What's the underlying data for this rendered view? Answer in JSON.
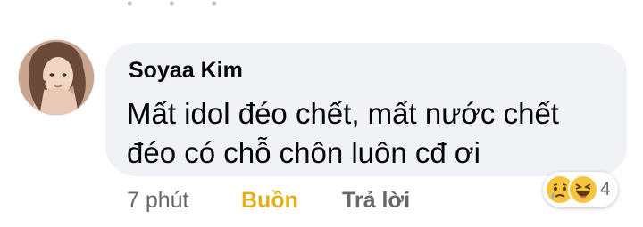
{
  "comment": {
    "author": "Soyaa Kim",
    "text": "Mất idol đéo chết, mất nước chết đéo có chỗ chôn luôn cđ ơi",
    "time": "7 phút",
    "reaction_label": "Buồn",
    "reply_label": "Trả lời",
    "reactions": {
      "icons": [
        "sad-emoji-icon",
        "haha-emoji-icon"
      ],
      "count": "4"
    }
  },
  "colors": {
    "bubble": "#f0f2f5",
    "reaction_active": "#e0b11c",
    "secondary_text": "#65676b"
  }
}
